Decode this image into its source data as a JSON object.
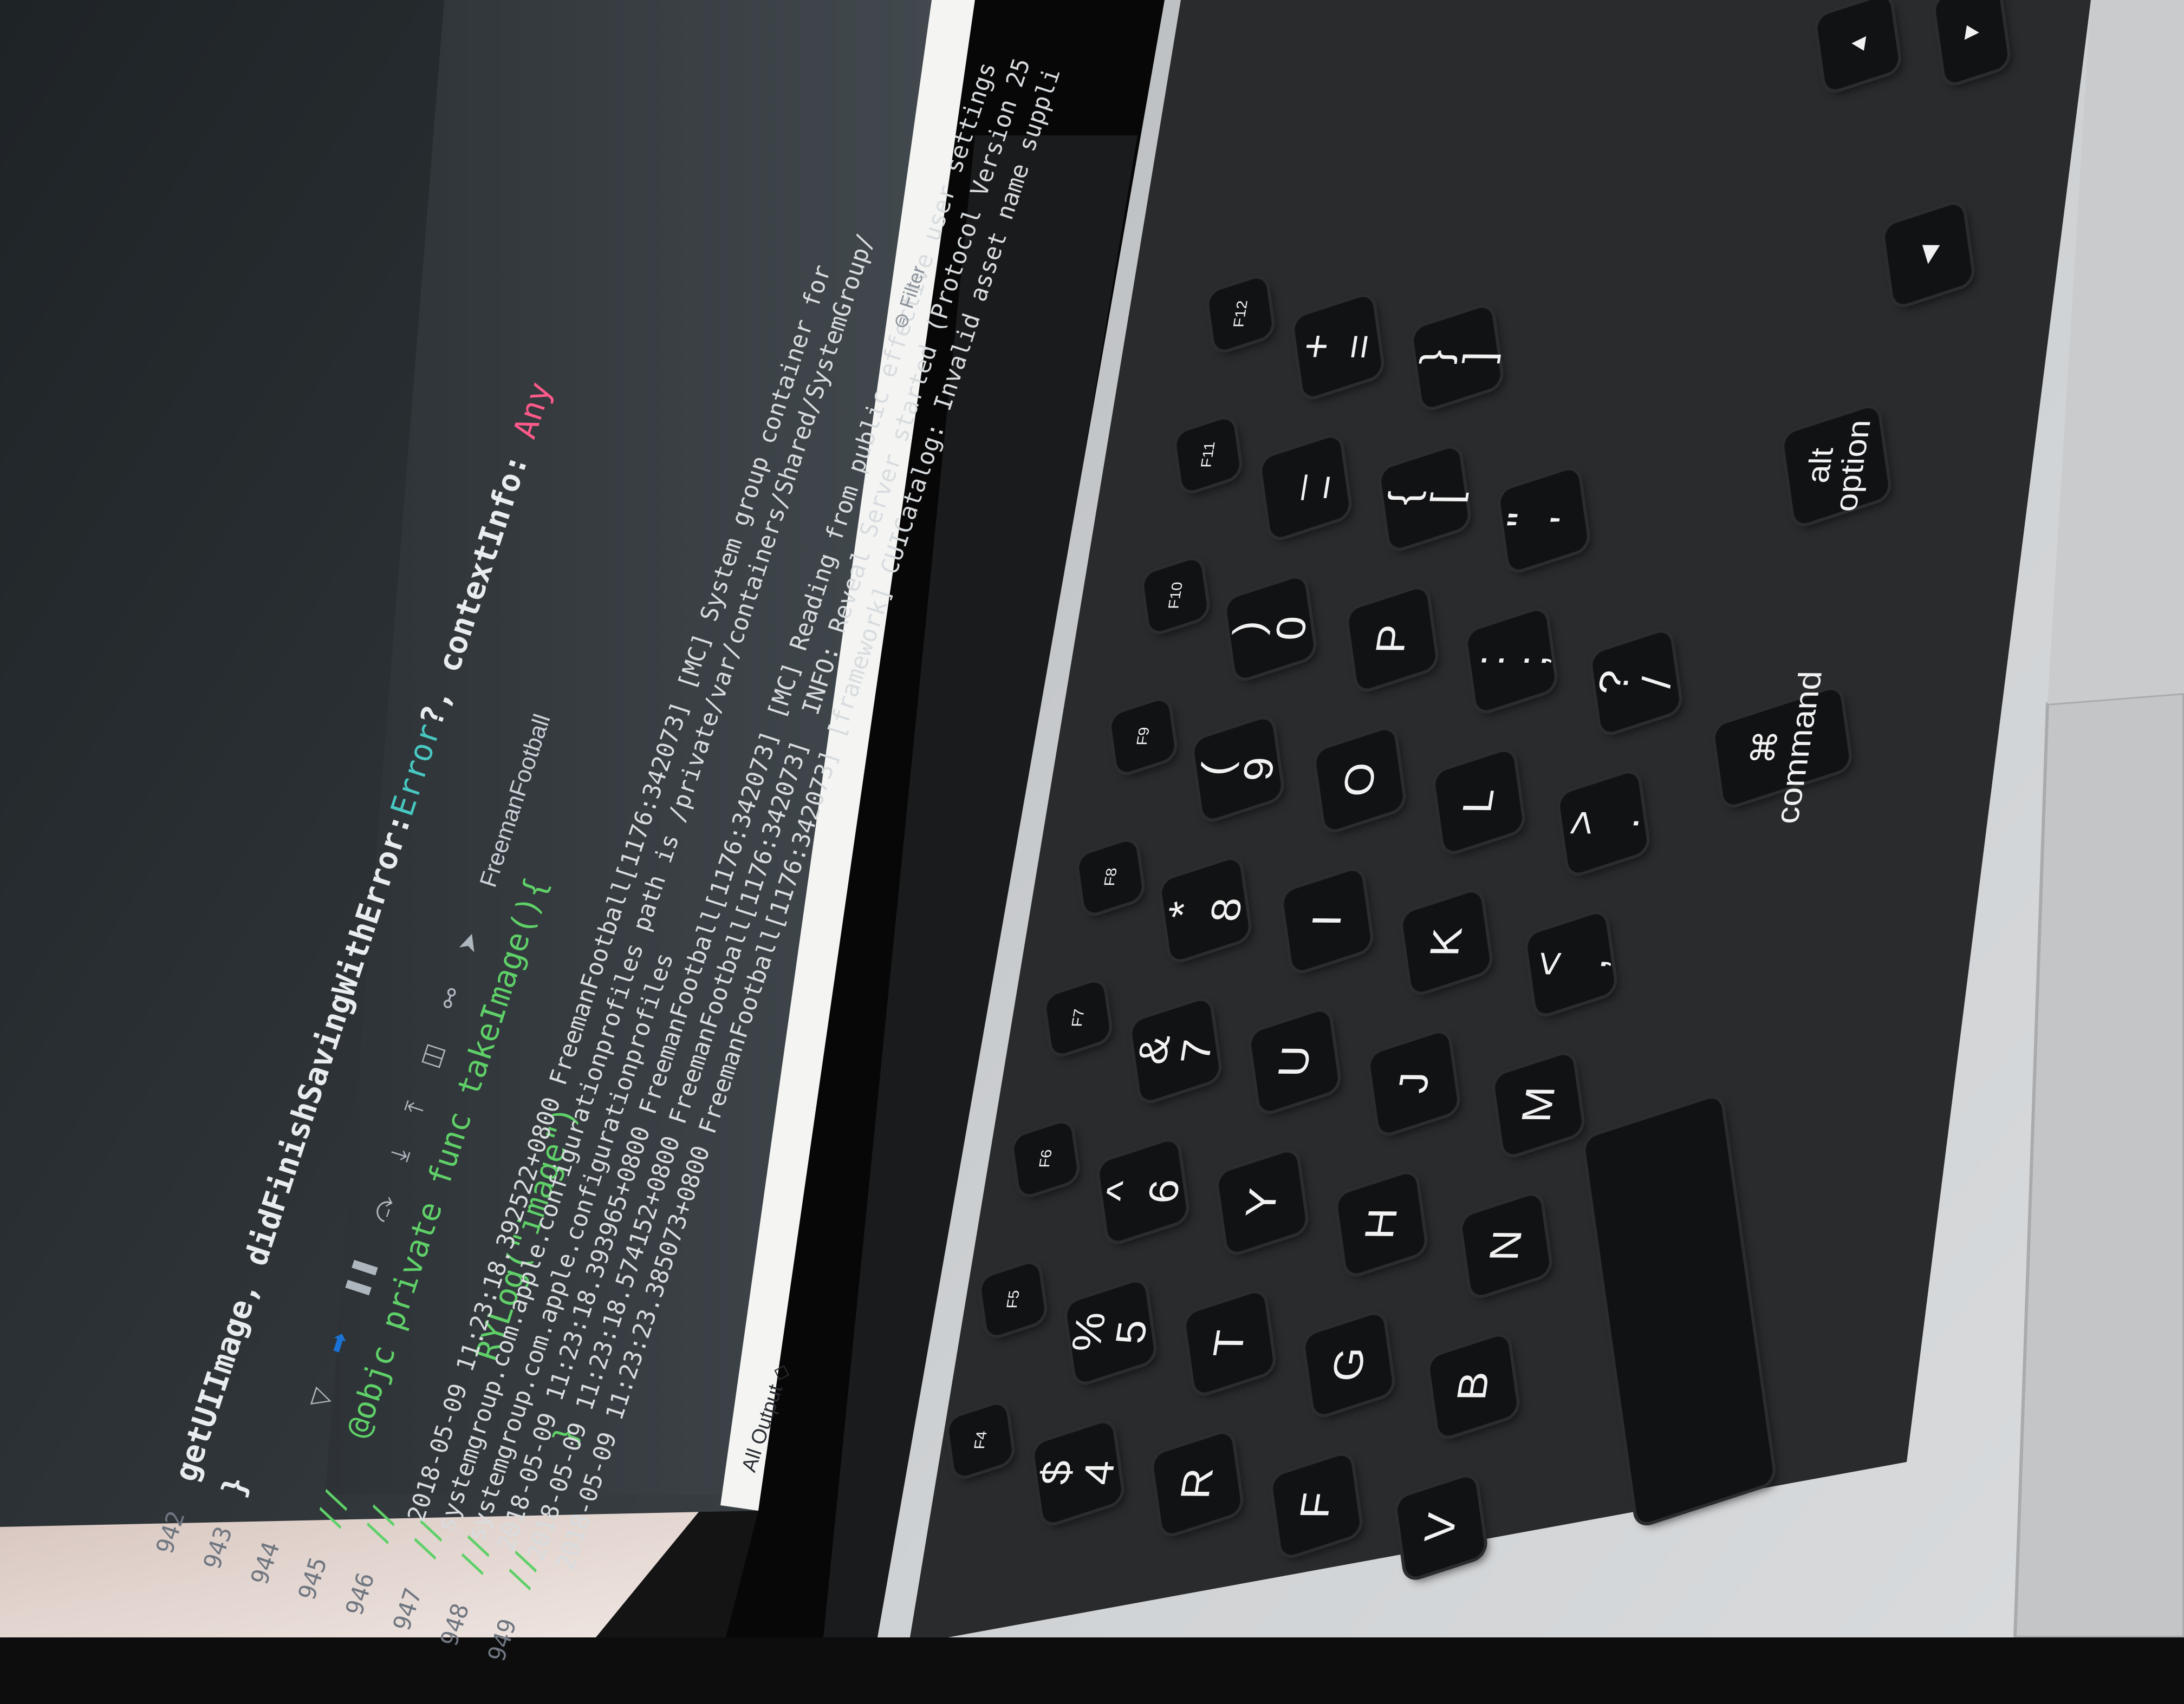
{
  "editor": {
    "line_numbers": [
      "942",
      "943",
      "944",
      "945",
      "946",
      "947",
      "948",
      "949"
    ],
    "partial_signature": {
      "arg_fragment": "getUIImage, ",
      "selector": "didFinishSavingWithError:",
      "type": "Error",
      "rest": "?, contextInfo: ",
      "tail": "Any"
    },
    "brace": "}",
    "func_decl": "@objc private func takeImage(){",
    "func_body": "RYLog(\"image\")",
    "func_close": "}",
    "comment_prefix": "//"
  },
  "console_toolbar": {
    "app_name": "FreemanFootball",
    "filter_placeholder": "Filter",
    "output_selector": "All Output ◇"
  },
  "console_lines": [
    "2018-05-09 11:23:18.392522+0800 FreemanFootball[1176:342073] [MC] System group container for",
    "systemgroup.com.apple.configurationprofiles path is /private/var/containers/Shared/SystemGroup/",
    "systemgroup.com.apple.configurationprofiles",
    "2018-05-09 11:23:18.393965+0800 FreemanFootball[1176:342073] [MC] Reading from public effective user settings",
    "2018-05-09 11:23:18.574152+0800 FreemanFootball[1176:342073]  INFO: Reveal Server started (Protocol Version 25",
    "2018-05-09 11:23:23.385073+0800 FreemanFootball[1176:342073] [framework] CUICatalog: Invalid asset name suppli"
  ],
  "keyboard": {
    "keys": [
      {
        "label": "$\n4"
      },
      {
        "label": "%\n5"
      },
      {
        "label": "^\n6"
      },
      {
        "label": "&\n7"
      },
      {
        "label": "*\n8"
      },
      {
        "label": "(\n9"
      },
      {
        "label": ")\n0"
      },
      {
        "label": "_\n−"
      },
      {
        "label": "+\n="
      },
      {
        "label": "R"
      },
      {
        "label": "T"
      },
      {
        "label": "Y"
      },
      {
        "label": "U"
      },
      {
        "label": "I"
      },
      {
        "label": "O"
      },
      {
        "label": "P"
      },
      {
        "label": "{\n["
      },
      {
        "label": "}\n]"
      },
      {
        "label": "F"
      },
      {
        "label": "G"
      },
      {
        "label": "H"
      },
      {
        "label": "J"
      },
      {
        "label": "K"
      },
      {
        "label": "L"
      },
      {
        "label": ":\n;"
      },
      {
        "label": "\"\n'"
      },
      {
        "label": "V"
      },
      {
        "label": "B"
      },
      {
        "label": "N"
      },
      {
        "label": "M"
      },
      {
        "label": "<\n,"
      },
      {
        "label": ">\n."
      },
      {
        "label": "?\n/"
      },
      {
        "label": "⌘\ncommand"
      },
      {
        "label": "alt\noption"
      },
      {
        "label": ""
      },
      {
        "label": "F4"
      },
      {
        "label": "F5"
      },
      {
        "label": "F6"
      },
      {
        "label": "F7"
      },
      {
        "label": "F8"
      },
      {
        "label": "F9"
      },
      {
        "label": "F10"
      },
      {
        "label": "F11"
      },
      {
        "label": "F12"
      },
      {
        "label": "▲"
      },
      {
        "label": "▼"
      },
      {
        "label": "◀"
      }
    ]
  }
}
